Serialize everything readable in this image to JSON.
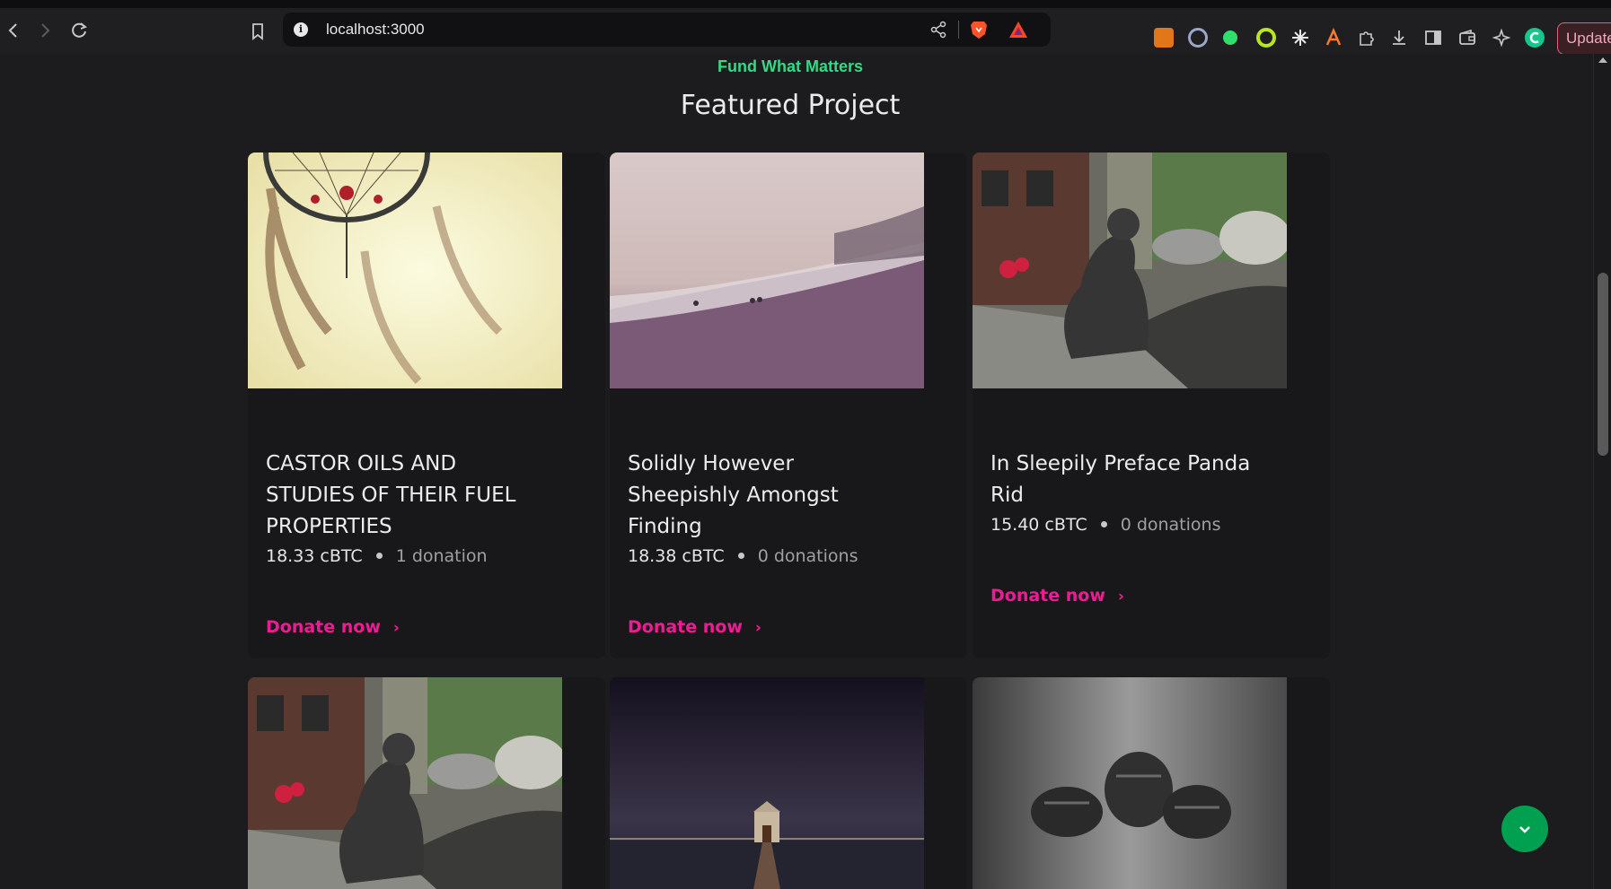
{
  "browser": {
    "url": "localhost:3000",
    "update_label": "Update",
    "icons": [
      "back-icon",
      "forward-icon",
      "reload-icon",
      "bookmark-icon",
      "site-info-icon",
      "share-icon",
      "brave-shields-icon",
      "brave-rewards-icon",
      "metamask-icon",
      "extension-icon",
      "extensions-puzzle-icon",
      "downloads-icon",
      "sidebar-icon",
      "wallet-icon",
      "leo-ai-icon",
      "profile-icon"
    ]
  },
  "hero": {
    "eyebrow": "Fund What Matters",
    "title": "Featured Project"
  },
  "projects": [
    {
      "title": "CASTOR OILS AND STUDIES OF THEIR FUEL PROPERTIES",
      "amount": "18.33 cBTC",
      "donations": "1 donation",
      "cta": "Donate now",
      "image": "dreamcatcher"
    },
    {
      "title": "Solidly However Sheepishly Amongst Finding",
      "amount": "18.38 cBTC",
      "donations": "0 donations",
      "cta": "Donate now",
      "image": "misty-beach"
    },
    {
      "title": "In Sleepily Preface Panda Rid",
      "amount": "15.40 cBTC",
      "donations": "0 donations",
      "cta": "Donate now",
      "image": "cat-statue"
    },
    {
      "image": "cat-statue"
    },
    {
      "image": "boathouse-night"
    },
    {
      "image": "pine-cones"
    }
  ],
  "colors": {
    "accent_green": "#2fdc84",
    "donate_pink": "#f01b94",
    "fab_green": "#00a050",
    "background": "#1c1c1e",
    "card": "#18181a"
  }
}
